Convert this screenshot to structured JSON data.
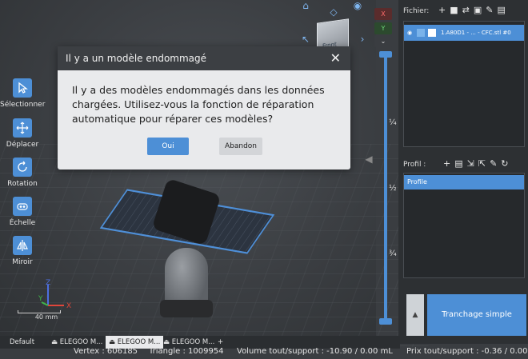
{
  "toolbar": {
    "items": [
      {
        "label": "Sélectionner"
      },
      {
        "label": "Déplacer"
      },
      {
        "label": "Rotation"
      },
      {
        "label": "Échelle"
      },
      {
        "label": "Miroir"
      }
    ]
  },
  "viewport": {
    "viewcube_label": "Front",
    "scale_label": "40 mm",
    "axes": {
      "x": "X",
      "y": "Y",
      "z": "Z"
    }
  },
  "layer_slider": {
    "marks": [
      "¼",
      "½",
      "¾"
    ],
    "axis_buttons": {
      "x": "X",
      "y": "Y"
    }
  },
  "dialog": {
    "title": "Il y a un modèle endommagé",
    "message": "Il y a des modèles endommagés dans les données chargées. Utilisez-vous la fonction de réparation automatique pour réparer ces modèles?",
    "ok_label": "Oui",
    "cancel_label": "Abandon"
  },
  "files": {
    "header": "Fichier:",
    "items": [
      {
        "name": "1.A80D1 - ... - CFC.stl #0"
      }
    ]
  },
  "profiles": {
    "header": "Profil :",
    "items": [
      {
        "name": "Profile"
      }
    ]
  },
  "slice": {
    "label": "Tranchage simple"
  },
  "tabs": [
    {
      "label": "Default"
    },
    {
      "label": "ELEGOO M..."
    },
    {
      "label": "ELEGOO M..."
    },
    {
      "label": "ELEGOO M..."
    }
  ],
  "tabs_add": "+",
  "status": {
    "vertex": "Vertex : 606185",
    "triangle": "Triangle : 1009954",
    "volume": "Volume tout/support : -10.90 / 0.00 mL",
    "price": "Prix tout/support : -0.36 / 0.00"
  },
  "colors": {
    "accent": "#4d8fd6",
    "dialog_bg": "#e9eaec",
    "panel_bg": "#2d3033"
  }
}
